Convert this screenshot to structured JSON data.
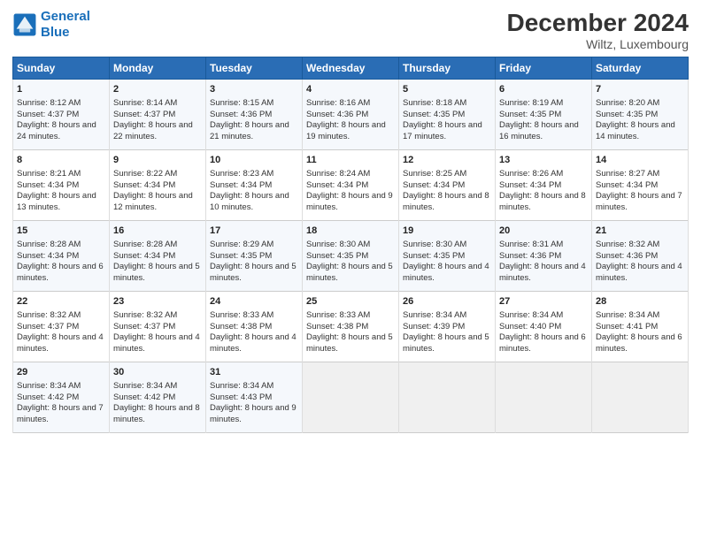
{
  "header": {
    "logo_line1": "General",
    "logo_line2": "Blue",
    "month": "December 2024",
    "location": "Wiltz, Luxembourg"
  },
  "days_of_week": [
    "Sunday",
    "Monday",
    "Tuesday",
    "Wednesday",
    "Thursday",
    "Friday",
    "Saturday"
  ],
  "weeks": [
    [
      {
        "day": "1",
        "sunrise": "8:12 AM",
        "sunset": "4:37 PM",
        "daylight": "8 hours and 24 minutes."
      },
      {
        "day": "2",
        "sunrise": "8:14 AM",
        "sunset": "4:37 PM",
        "daylight": "8 hours and 22 minutes."
      },
      {
        "day": "3",
        "sunrise": "8:15 AM",
        "sunset": "4:36 PM",
        "daylight": "8 hours and 21 minutes."
      },
      {
        "day": "4",
        "sunrise": "8:16 AM",
        "sunset": "4:36 PM",
        "daylight": "8 hours and 19 minutes."
      },
      {
        "day": "5",
        "sunrise": "8:18 AM",
        "sunset": "4:35 PM",
        "daylight": "8 hours and 17 minutes."
      },
      {
        "day": "6",
        "sunrise": "8:19 AM",
        "sunset": "4:35 PM",
        "daylight": "8 hours and 16 minutes."
      },
      {
        "day": "7",
        "sunrise": "8:20 AM",
        "sunset": "4:35 PM",
        "daylight": "8 hours and 14 minutes."
      }
    ],
    [
      {
        "day": "8",
        "sunrise": "8:21 AM",
        "sunset": "4:34 PM",
        "daylight": "8 hours and 13 minutes."
      },
      {
        "day": "9",
        "sunrise": "8:22 AM",
        "sunset": "4:34 PM",
        "daylight": "8 hours and 12 minutes."
      },
      {
        "day": "10",
        "sunrise": "8:23 AM",
        "sunset": "4:34 PM",
        "daylight": "8 hours and 10 minutes."
      },
      {
        "day": "11",
        "sunrise": "8:24 AM",
        "sunset": "4:34 PM",
        "daylight": "8 hours and 9 minutes."
      },
      {
        "day": "12",
        "sunrise": "8:25 AM",
        "sunset": "4:34 PM",
        "daylight": "8 hours and 8 minutes."
      },
      {
        "day": "13",
        "sunrise": "8:26 AM",
        "sunset": "4:34 PM",
        "daylight": "8 hours and 8 minutes."
      },
      {
        "day": "14",
        "sunrise": "8:27 AM",
        "sunset": "4:34 PM",
        "daylight": "8 hours and 7 minutes."
      }
    ],
    [
      {
        "day": "15",
        "sunrise": "8:28 AM",
        "sunset": "4:34 PM",
        "daylight": "8 hours and 6 minutes."
      },
      {
        "day": "16",
        "sunrise": "8:28 AM",
        "sunset": "4:34 PM",
        "daylight": "8 hours and 5 minutes."
      },
      {
        "day": "17",
        "sunrise": "8:29 AM",
        "sunset": "4:35 PM",
        "daylight": "8 hours and 5 minutes."
      },
      {
        "day": "18",
        "sunrise": "8:30 AM",
        "sunset": "4:35 PM",
        "daylight": "8 hours and 5 minutes."
      },
      {
        "day": "19",
        "sunrise": "8:30 AM",
        "sunset": "4:35 PM",
        "daylight": "8 hours and 4 minutes."
      },
      {
        "day": "20",
        "sunrise": "8:31 AM",
        "sunset": "4:36 PM",
        "daylight": "8 hours and 4 minutes."
      },
      {
        "day": "21",
        "sunrise": "8:32 AM",
        "sunset": "4:36 PM",
        "daylight": "8 hours and 4 minutes."
      }
    ],
    [
      {
        "day": "22",
        "sunrise": "8:32 AM",
        "sunset": "4:37 PM",
        "daylight": "8 hours and 4 minutes."
      },
      {
        "day": "23",
        "sunrise": "8:32 AM",
        "sunset": "4:37 PM",
        "daylight": "8 hours and 4 minutes."
      },
      {
        "day": "24",
        "sunrise": "8:33 AM",
        "sunset": "4:38 PM",
        "daylight": "8 hours and 4 minutes."
      },
      {
        "day": "25",
        "sunrise": "8:33 AM",
        "sunset": "4:38 PM",
        "daylight": "8 hours and 5 minutes."
      },
      {
        "day": "26",
        "sunrise": "8:34 AM",
        "sunset": "4:39 PM",
        "daylight": "8 hours and 5 minutes."
      },
      {
        "day": "27",
        "sunrise": "8:34 AM",
        "sunset": "4:40 PM",
        "daylight": "8 hours and 6 minutes."
      },
      {
        "day": "28",
        "sunrise": "8:34 AM",
        "sunset": "4:41 PM",
        "daylight": "8 hours and 6 minutes."
      }
    ],
    [
      {
        "day": "29",
        "sunrise": "8:34 AM",
        "sunset": "4:42 PM",
        "daylight": "8 hours and 7 minutes."
      },
      {
        "day": "30",
        "sunrise": "8:34 AM",
        "sunset": "4:42 PM",
        "daylight": "8 hours and 8 minutes."
      },
      {
        "day": "31",
        "sunrise": "8:34 AM",
        "sunset": "4:43 PM",
        "daylight": "8 hours and 9 minutes."
      },
      null,
      null,
      null,
      null
    ]
  ]
}
